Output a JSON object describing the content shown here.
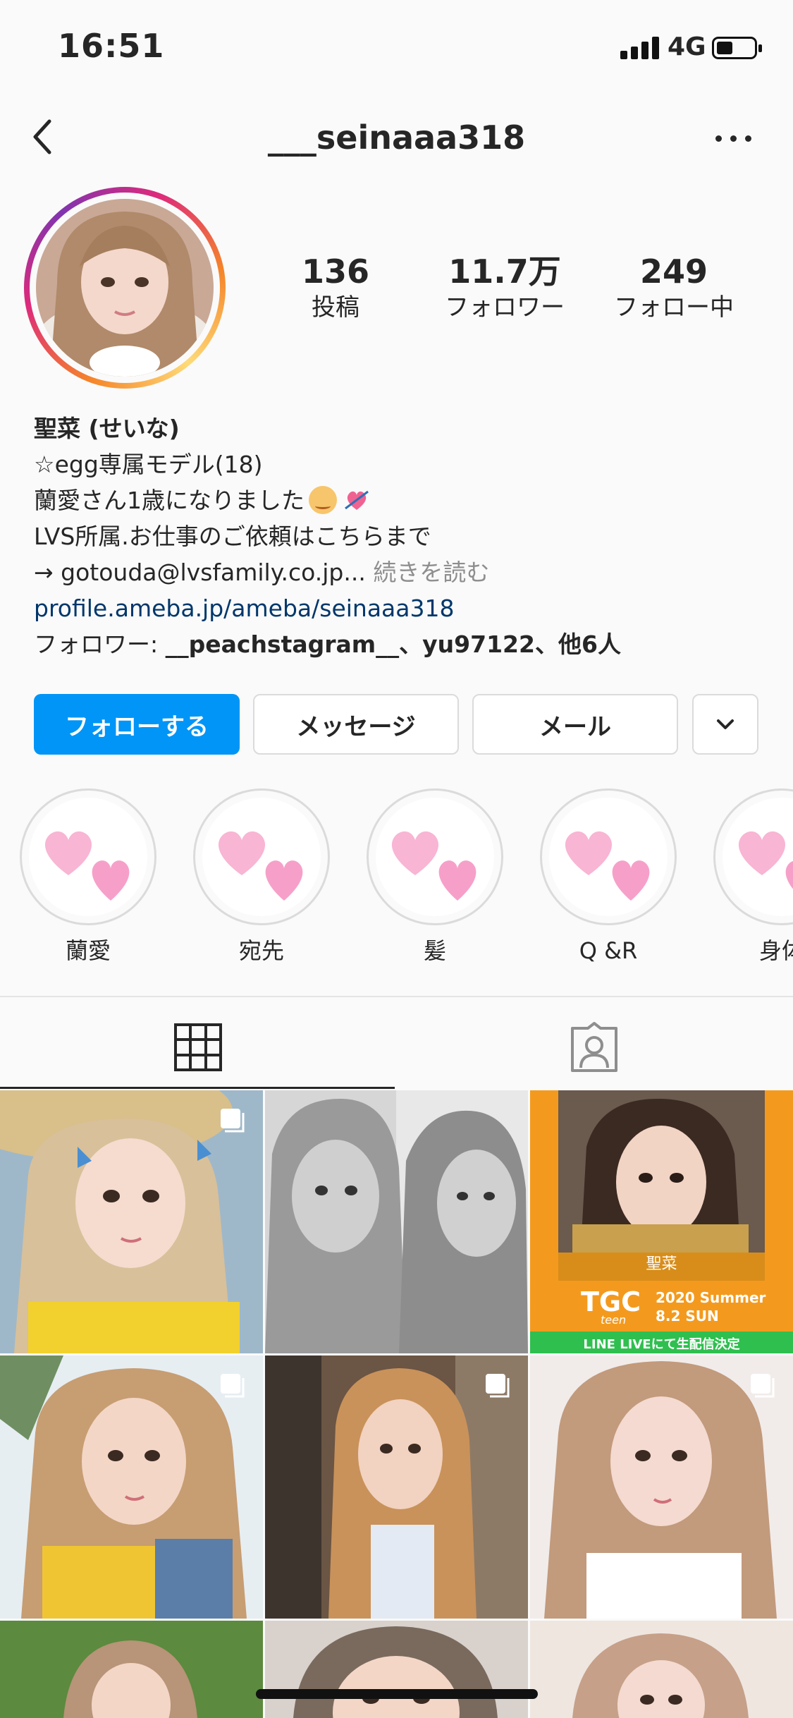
{
  "status_bar": {
    "time": "16:51",
    "network": "4G"
  },
  "header": {
    "username": "___seinaaa318"
  },
  "stats": [
    {
      "value": "136",
      "label": "投稿"
    },
    {
      "value": "11.7万",
      "label": "フォロワー"
    },
    {
      "value": "249",
      "label": "フォロー中"
    }
  ],
  "bio": {
    "name": "聖菜 (せいな)",
    "line1": "☆egg専属モデル(18)",
    "line2": "蘭愛さん1歳になりました",
    "line3": "LVS所属.お仕事のご依頼はこちらまで",
    "line4": "→ gotouda@lvsfamily.co.jp...",
    "more": " 続きを読む",
    "link": "profile.ameba.jp/ameba/seinaaa318",
    "followers_prefix": "フォロワー: ",
    "followers_names": "__peachstagram__、yu97122、他6人"
  },
  "buttons": {
    "follow": "フォローする",
    "message": "メッセージ",
    "mail": "メール"
  },
  "highlights": [
    {
      "label": "蘭愛"
    },
    {
      "label": "宛先"
    },
    {
      "label": "髪"
    },
    {
      "label": "Q &R"
    },
    {
      "label": "身体"
    }
  ],
  "tabs": {
    "grid_icon": "grid-icon",
    "tagged_icon": "tagged-person-icon"
  },
  "posts": {
    "tgc_name": "聖菜",
    "tgc_logo": "TGC",
    "tgc_sub": "teen",
    "tgc_season": "2020 Summer",
    "tgc_date": "8.2 SUN",
    "tgc_banner": "LINE LIVEにて生配信決定"
  },
  "colors": {
    "follow_blue": "#0095f6",
    "link_blue": "#00376b",
    "muted": "#8e8e8e",
    "tgc_orange": "#f39a1e",
    "tgc_green": "#2fbf4f"
  }
}
